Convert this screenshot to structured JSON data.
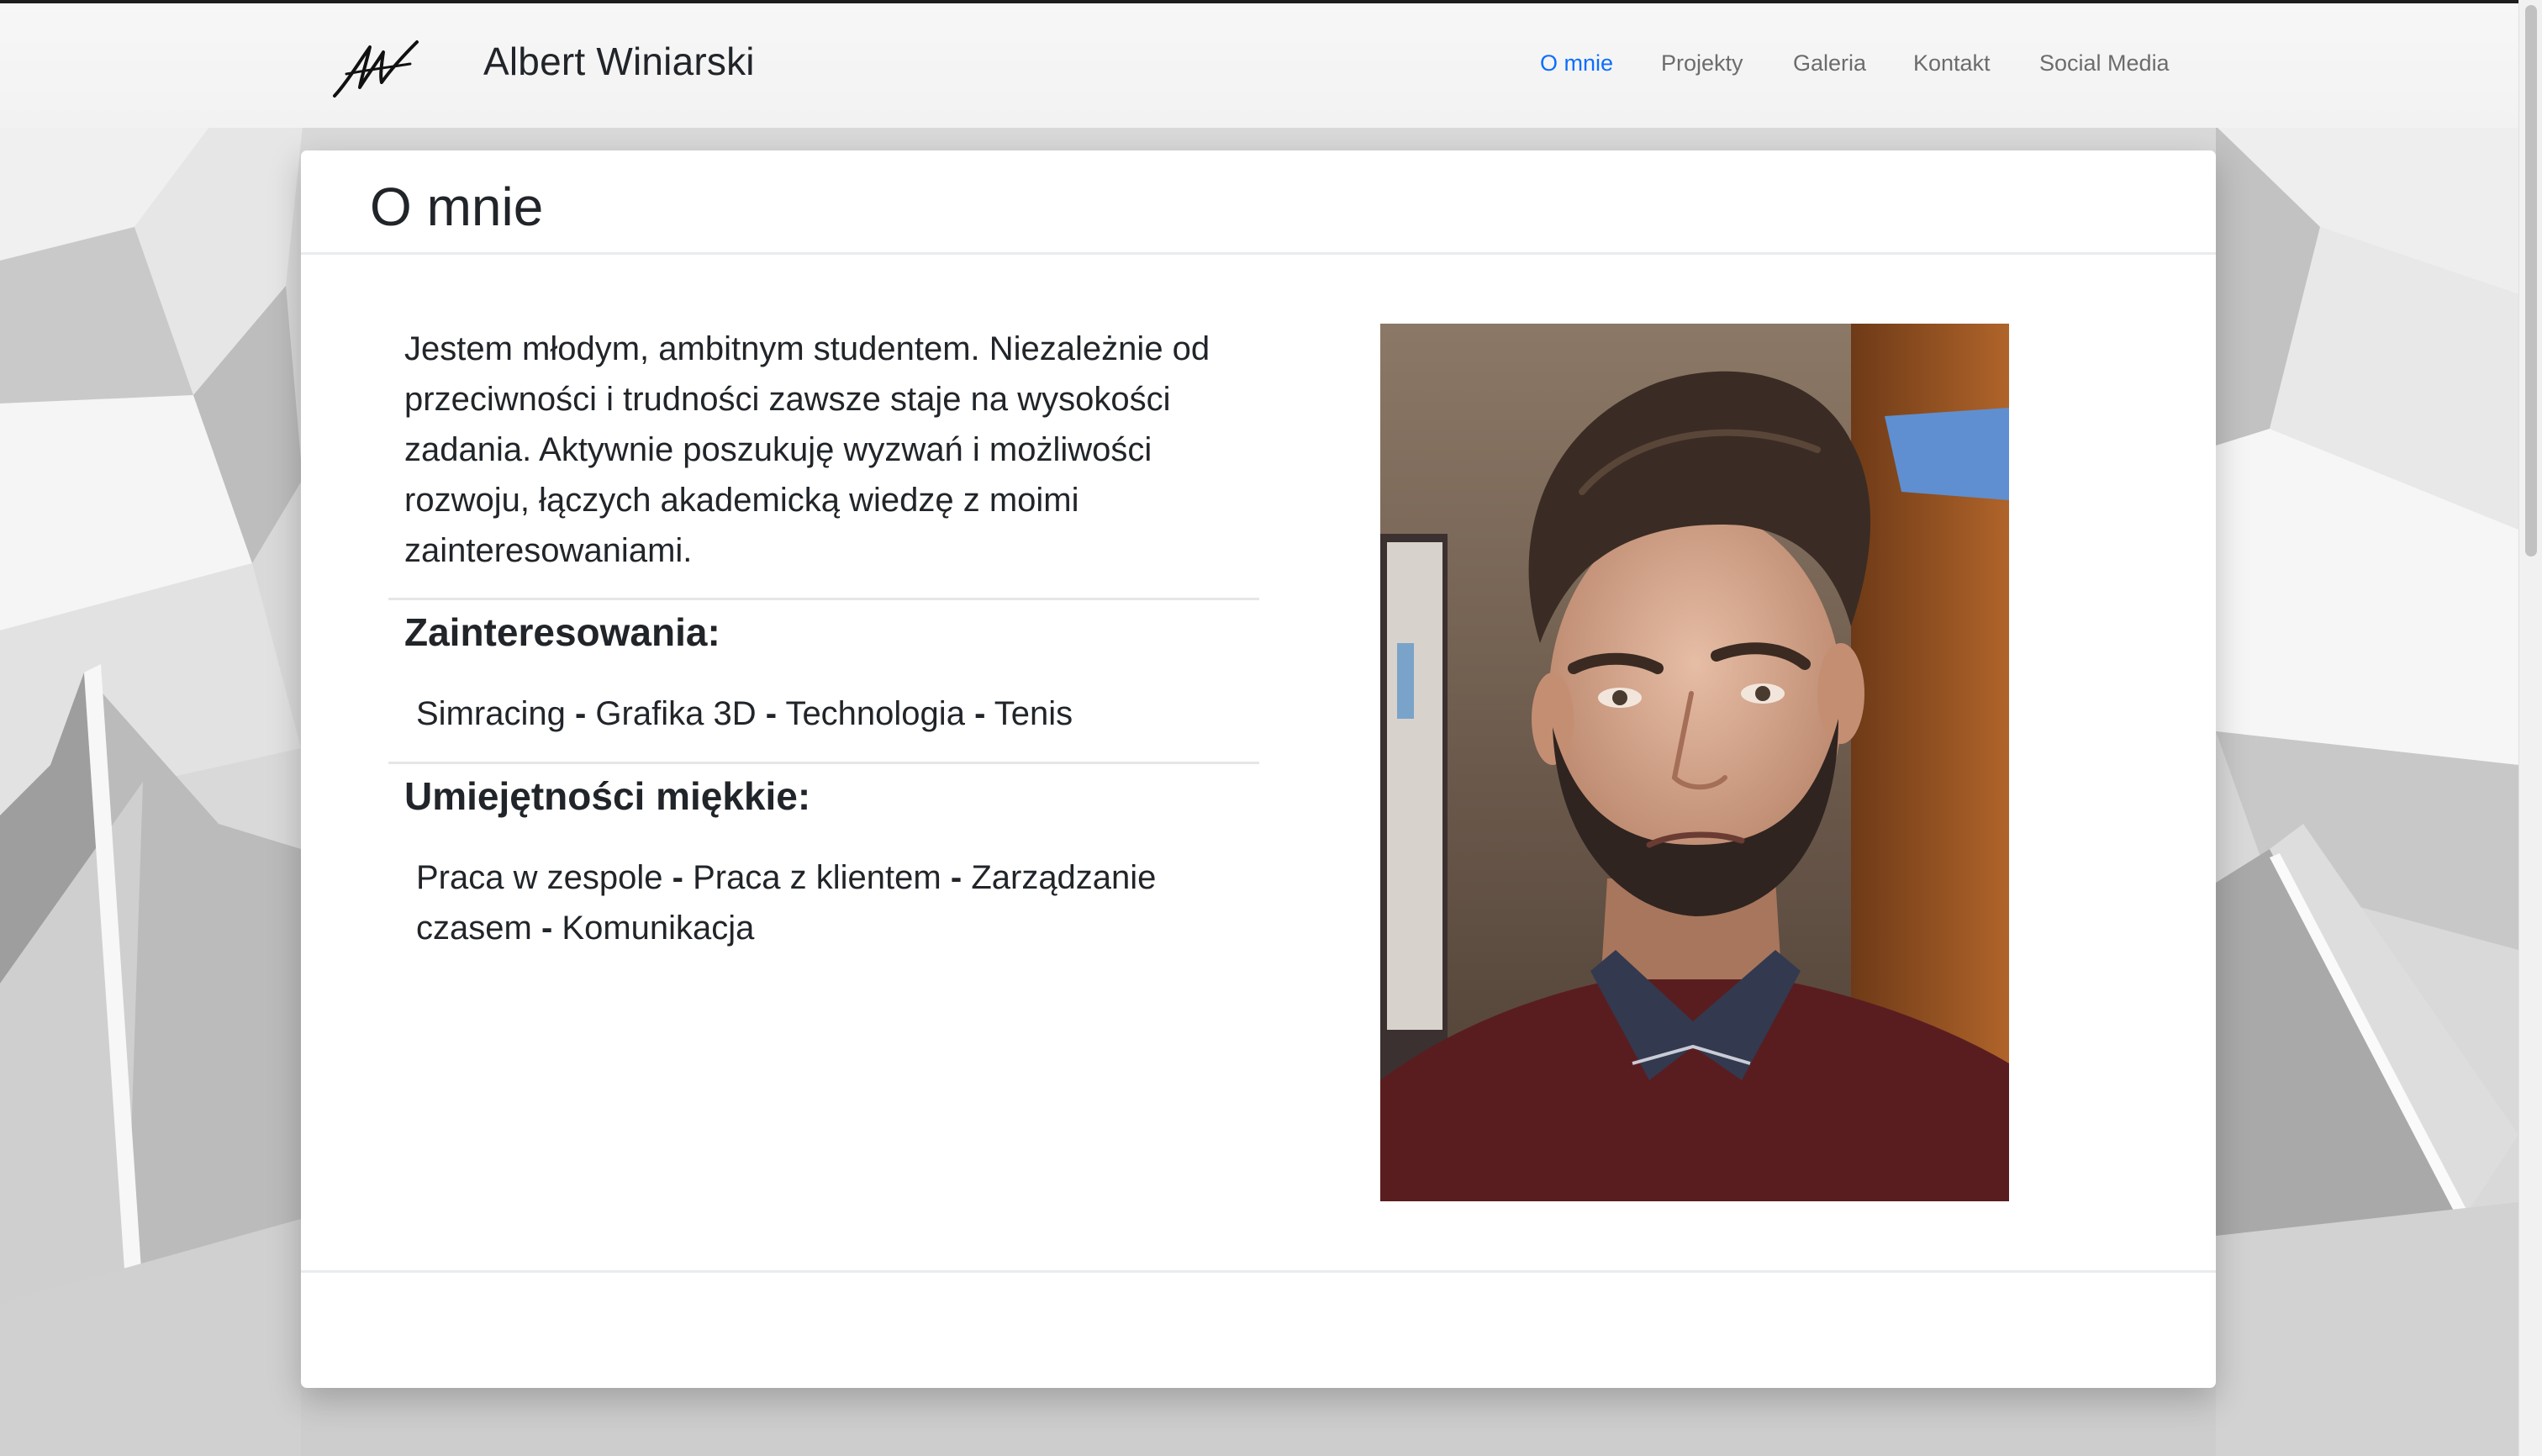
{
  "brand": {
    "name": "Albert Winiarski",
    "logo": "signature-logo"
  },
  "nav": {
    "items": [
      {
        "label": "O mnie",
        "active": true
      },
      {
        "label": "Projekty",
        "active": false
      },
      {
        "label": "Galeria",
        "active": false
      },
      {
        "label": "Kontakt",
        "active": false
      },
      {
        "label": "Social Media",
        "active": false
      }
    ]
  },
  "about": {
    "title": "O mnie",
    "intro": "Jestem młodym, ambitnym studentem. Niezależnie od przeciwności i trudności zawsze staje na wysokości zadania. Aktywnie poszukuję wyzwań i możliwości rozwoju, łączych akademicką wiedzę z moimi zainteresowaniami.",
    "interests": {
      "title": "Zainteresowania:",
      "items": [
        "Simracing",
        "Grafika 3D",
        "Technologia",
        "Tenis"
      ],
      "separator": "-"
    },
    "soft_skills": {
      "title": "Umiejętności miękkie:",
      "items": [
        "Praca w zespole",
        "Praca z klientem",
        "Zarządzanie czasem",
        "Komunikacja"
      ],
      "separator": "-"
    },
    "photo": "profile-photo"
  },
  "colors": {
    "nav_active": "#0d6efd",
    "nav_text": "#6c6c6c",
    "text": "#212529"
  }
}
